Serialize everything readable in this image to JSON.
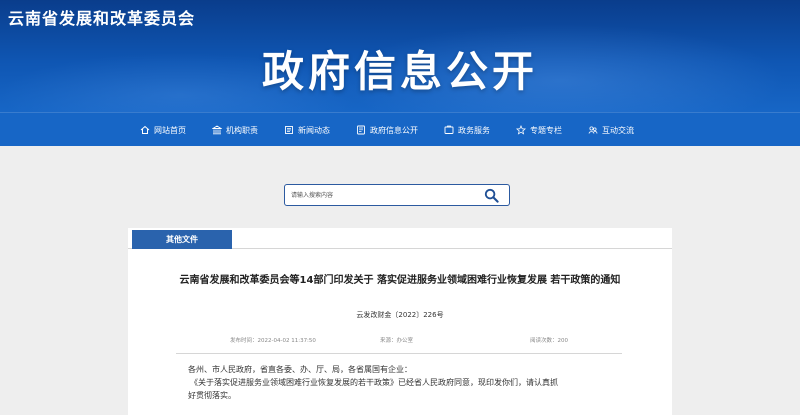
{
  "header": {
    "site_name": "云南省发展和改革委员会",
    "banner_title": "政府信息公开"
  },
  "nav": {
    "items": [
      {
        "label": "网站首页",
        "icon": "home-icon"
      },
      {
        "label": "机构职责",
        "icon": "institution-icon"
      },
      {
        "label": "新闻动态",
        "icon": "news-icon"
      },
      {
        "label": "政府信息公开",
        "icon": "info-disclosure-icon"
      },
      {
        "label": "政务服务",
        "icon": "service-icon"
      },
      {
        "label": "专题专栏",
        "icon": "topic-icon"
      },
      {
        "label": "互动交流",
        "icon": "interaction-icon"
      }
    ]
  },
  "search": {
    "placeholder": "请输入搜索内容",
    "value": ""
  },
  "content": {
    "tab_label": "其他文件",
    "title": "云南省发展和改革委员会等14部门印发关于 落实促进服务业领域困难行业恢复发展 若干政策的通知",
    "doc_number": "云发改财金〔2022〕226号",
    "meta": {
      "publish_time": "发布时间：2022-04-02 11:37:50",
      "source": "来源：办公室",
      "views": "阅读次数：200"
    },
    "body": {
      "salutation": "各州、市人民政府，省直各委、办、厅、局，各省属国有企业：",
      "paragraph_1": "《关于落实促进服务业领域困难行业恢复发展的若干政策》已经省人民政府同意，现印发你们，请认真抓",
      "paragraph_1_cont": "好贯彻落实。"
    }
  },
  "colors": {
    "banner": "#0f56b3",
    "nav": "#1766c6",
    "tab": "#2a63ad",
    "search_border": "#2c5aa0"
  }
}
